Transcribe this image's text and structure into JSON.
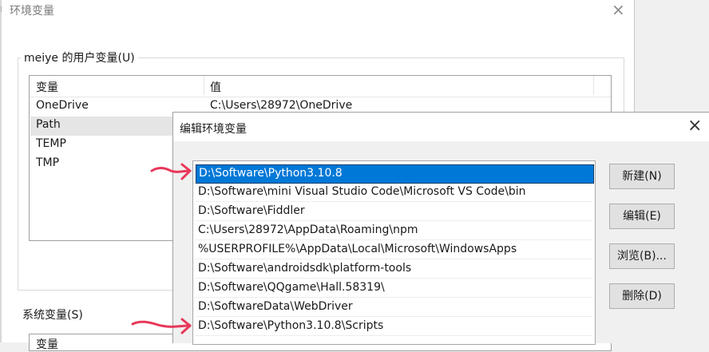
{
  "env_window": {
    "title": "环境变量",
    "user_group_label": "meiye 的用户变量(U)",
    "columns": [
      "变量",
      "值"
    ],
    "user_vars": [
      {
        "name": "OneDrive",
        "value": "C:\\Users\\28972\\OneDrive",
        "selected": false
      },
      {
        "name": "Path",
        "value": "",
        "selected": true
      },
      {
        "name": "TEMP",
        "value": "",
        "selected": false
      },
      {
        "name": "TMP",
        "value": "",
        "selected": false
      }
    ],
    "system_group_label": "系统变量(S)",
    "system_column_header": "变量"
  },
  "edit_dialog": {
    "title": "编辑环境变量",
    "paths": [
      "D:\\Software\\Python3.10.8",
      "D:\\Software\\mini Visual Studio Code\\Microsoft VS Code\\bin",
      "D:\\Software\\Fiddler",
      "C:\\Users\\28972\\AppData\\Roaming\\npm",
      "%USERPROFILE%\\AppData\\Local\\Microsoft\\WindowsApps",
      "D:\\Software\\androidsdk\\platform-tools",
      "D:\\Software\\QQgame\\Hall.58319\\",
      "D:\\SoftwareData\\WebDriver",
      "D:\\Software\\Python3.10.8\\Scripts"
    ],
    "selected_index": 0,
    "buttons": {
      "new": "新建(N)",
      "edit": "编辑(E)",
      "browse": "浏览(B)...",
      "delete": "删除(D)"
    }
  },
  "colors": {
    "selection": "#0078d7",
    "annotation_arrow": "#e8385a"
  },
  "icons": {
    "close": "×"
  }
}
